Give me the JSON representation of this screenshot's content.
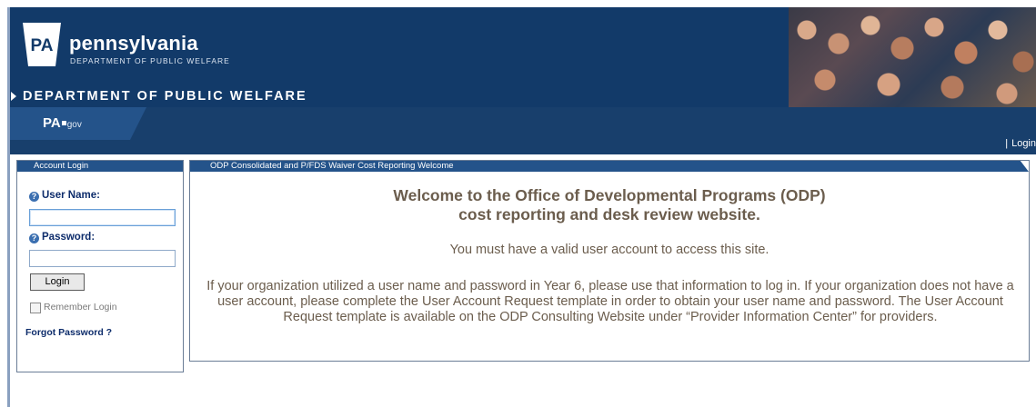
{
  "header": {
    "logo_badge": "PA",
    "brand": "pennsylvania",
    "brand_sub": "DEPARTMENT OF PUBLIC WELFARE",
    "department_banner": "DEPARTMENT OF PUBLIC WELFARE",
    "colors": {
      "header_bg": "#123a69",
      "nav_bg": "#183f6c",
      "panel_head": "#24538a"
    }
  },
  "nav": {
    "pagov_main": "PA",
    "pagov_sub": "gov",
    "login_separator": "|",
    "login_link": "Login"
  },
  "login_panel": {
    "title": "Account Login",
    "username_label": "User Name:",
    "username_value": "",
    "password_label": "Password:",
    "password_value": "",
    "login_button": "Login",
    "remember_label": "Remember Login",
    "remember_checked": false,
    "forgot_link": "Forgot Password ?",
    "help_icon": "question-circle-icon"
  },
  "main_panel": {
    "title": "ODP Consolidated and P/FDS Waiver Cost Reporting Welcome",
    "welcome_line1": "Welcome to the Office of Developmental Programs (ODP)",
    "welcome_line2": "cost reporting and desk review website.",
    "valid_account": "You must have a valid user account to access this site.",
    "instructions": "If your organization utilized a user name and password in Year 6, please use that information to log in. If your organization does not have a user account, please complete the User Account Request template in order to obtain your user name and password. The User Account Request template is available on the ODP Consulting Website under “Provider Information Center” for providers."
  }
}
